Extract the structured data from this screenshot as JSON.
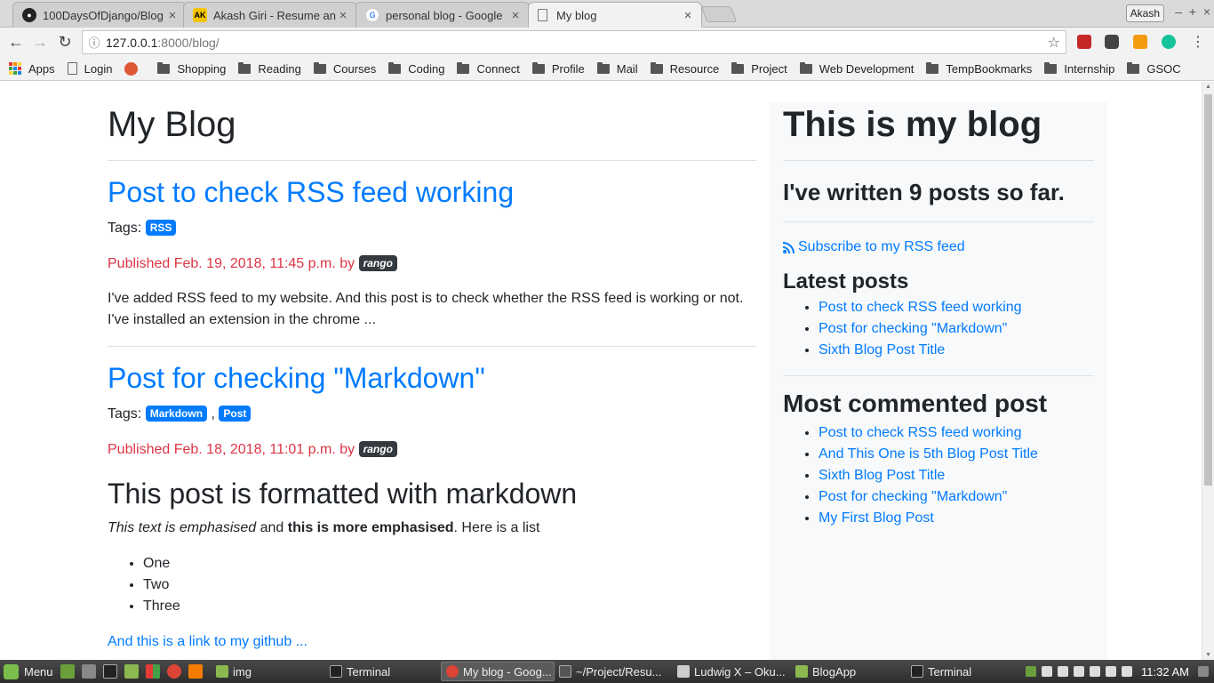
{
  "browser": {
    "tabs": [
      {
        "title": "100DaysOfDjango/Blog",
        "icon": "github-icon",
        "active": false
      },
      {
        "title": "Akash Giri - Resume an",
        "icon": "ak-logo-icon",
        "active": false
      },
      {
        "title": "personal blog - Google",
        "icon": "google-icon",
        "active": false
      },
      {
        "title": "My blog",
        "icon": "page-icon",
        "active": true
      }
    ],
    "profile_name": "Akash",
    "url_host": "127.0.0.1",
    "url_path": ":8000/blog/",
    "bookmarks": [
      {
        "label": "Apps",
        "icon": "apps-grid-icon"
      },
      {
        "label": "Login",
        "icon": "page-icon"
      },
      {
        "label": "",
        "icon": "duckduckgo-icon"
      },
      {
        "label": "Shopping",
        "icon": "folder-icon"
      },
      {
        "label": "Reading",
        "icon": "folder-icon"
      },
      {
        "label": "Courses",
        "icon": "folder-icon"
      },
      {
        "label": "Coding",
        "icon": "folder-icon"
      },
      {
        "label": "Connect",
        "icon": "folder-icon"
      },
      {
        "label": "Profile",
        "icon": "folder-icon"
      },
      {
        "label": "Mail",
        "icon": "folder-icon"
      },
      {
        "label": "Resource",
        "icon": "folder-icon"
      },
      {
        "label": "Project",
        "icon": "folder-icon"
      },
      {
        "label": "Web Development",
        "icon": "folder-icon"
      },
      {
        "label": "TempBookmarks",
        "icon": "folder-icon"
      },
      {
        "label": "Internship",
        "icon": "folder-icon"
      },
      {
        "label": "GSOC",
        "icon": "folder-icon"
      }
    ]
  },
  "page": {
    "title": "My Blog",
    "posts": [
      {
        "title": "Post to check RSS feed working",
        "tags_label": "Tags:",
        "tags": [
          "RSS"
        ],
        "published": "Published Feb. 19, 2018, 11:45 p.m. by",
        "author": "rango",
        "excerpt": "I've added RSS feed to my website. And this post is to check whether the RSS feed is working or not. I've installed an extension in the chrome ..."
      },
      {
        "title": "Post for checking \"Markdown\"",
        "tags_label": "Tags:",
        "tags": [
          "Markdown",
          "Post"
        ],
        "tag_separator": ",",
        "published": "Published Feb. 18, 2018, 11:01 p.m. by",
        "author": "rango",
        "md_heading": "This post is formatted with markdown",
        "md_em": "This text is emphasised",
        "md_and": " and ",
        "md_strong": "this is more emphasised",
        "md_tail": ". Here is a list",
        "md_list": [
          "One",
          "Two",
          "Three"
        ],
        "md_link": "And this is a link to my github ..."
      }
    ]
  },
  "sidebar": {
    "title": "This is my blog",
    "count_text": "I've written 9 posts so far.",
    "rss_link": "Subscribe to my RSS feed",
    "latest_heading": "Latest posts",
    "latest": [
      "Post to check RSS feed working",
      "Post for checking \"Markdown\"",
      "Sixth Blog Post Title"
    ],
    "most_commented_heading": "Most commented post",
    "most_commented": [
      "Post to check RSS feed working",
      "And This One is 5th Blog Post Title",
      "Sixth Blog Post Title",
      "Post for checking \"Markdown\"",
      "My First Blog Post"
    ]
  },
  "taskbar": {
    "menu_label": "Menu",
    "tasks": [
      {
        "label": "img",
        "icon": "folder-icon"
      },
      {
        "label": "Terminal",
        "icon": "terminal-icon"
      },
      {
        "label": "My blog - Goog...",
        "icon": "chrome-icon",
        "active": true
      },
      {
        "label": "~/Project/Resu...",
        "icon": "sublime-icon"
      },
      {
        "label": "Ludwig X – Oku...",
        "icon": "music-icon"
      },
      {
        "label": "BlogApp",
        "icon": "folder-icon"
      },
      {
        "label": "Terminal",
        "icon": "terminal-icon"
      }
    ],
    "clock": "11:32 AM"
  },
  "colors": {
    "link": "#007bff",
    "published": "#dc3545",
    "badge_primary": "#007bff",
    "badge_dark": "#343a40",
    "sidebar_bg": "#f8f9fa"
  }
}
